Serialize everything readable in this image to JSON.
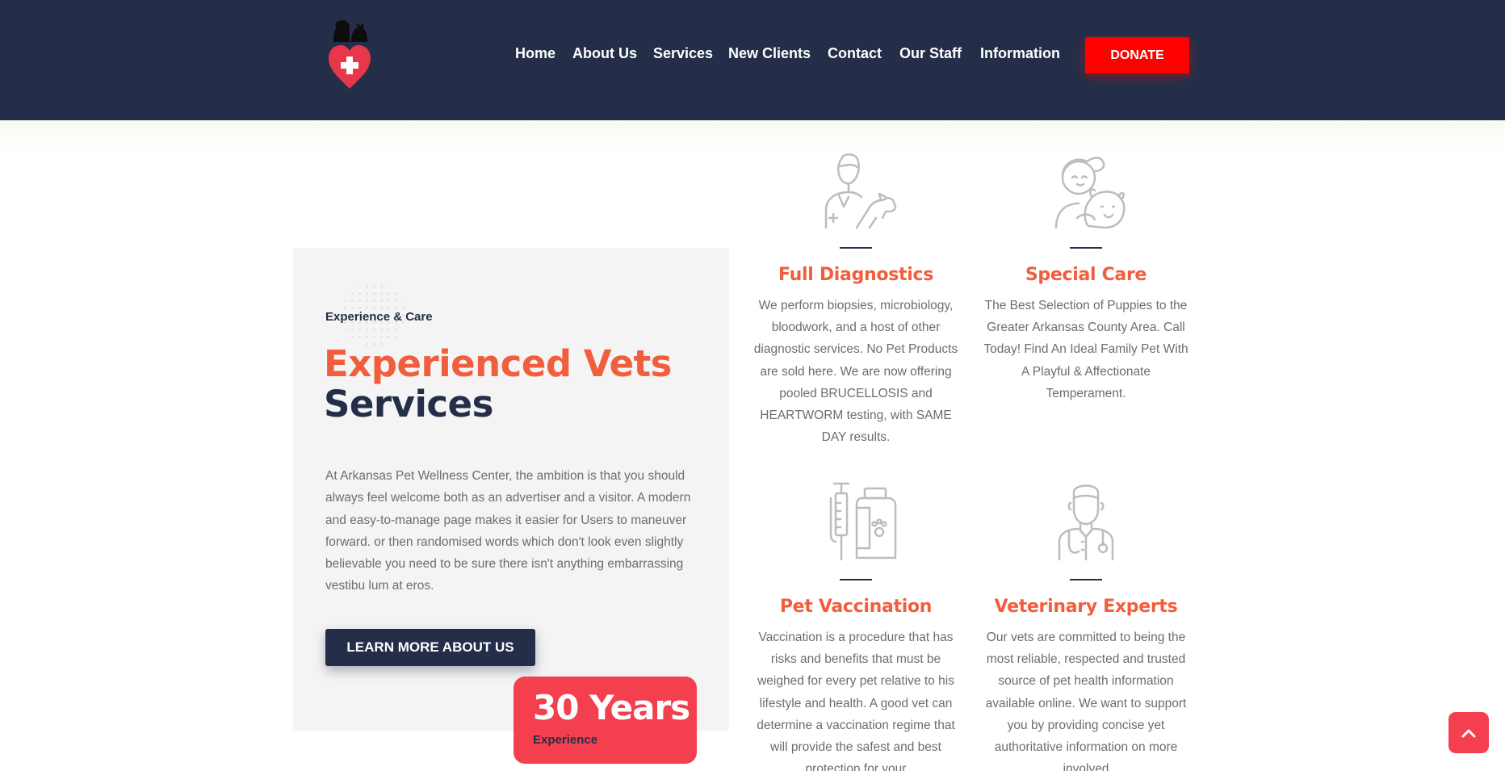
{
  "header": {
    "nav": [
      "Home",
      "About Us",
      "Services",
      "New Clients",
      "Contact",
      "Our Staff",
      "Information"
    ],
    "donate_label": "DONATE"
  },
  "about": {
    "eyebrow": "Experience & Care",
    "title_accent": "Experienced Vets",
    "title_main": "Services",
    "text": "At Arkansas Pet Wellness Center, the ambition is that you should always feel welcome both as an advertiser and a visitor. A modern and easy-to-manage page makes it easier for Users to maneuver forward. or then randomised words which don't look even slightly believable you need to be sure there isn't anything embarrassing vestibu lum at eros.",
    "button_label": "LEARN MORE ABOUT US",
    "years_number": "30 Years",
    "years_label": "Experience"
  },
  "services": [
    {
      "icon": "vet-with-dog-icon",
      "title": "Full Diagnostics",
      "text": "We perform biopsies, microbiology, bloodwork, and a host of other diagnostic services. No Pet Products are sold here. We are now offering pooled BRUCELLOSIS and HEARTWORM testing, with SAME DAY results."
    },
    {
      "icon": "girl-with-puppy-icon",
      "title": "Special Care",
      "text": "The Best Selection of Puppies to the Greater Arkansas County Area. Call Today! Find An Ideal Family Pet With A Playful & Affectionate Temperament."
    },
    {
      "icon": "syringe-and-bottle-icon",
      "title": "Pet Vaccination",
      "text": "Vaccination is a procedure that has risks and benefits that must be weighed for every pet relative to his lifestyle and health. A good vet can determine a vaccination regime that will provide the safest and best protection for your"
    },
    {
      "icon": "doctor-with-stethoscope-icon",
      "title": "Veterinary Experts",
      "text": "Our vets are committed to being the most reliable, respected and trusted source of pet health information available online. We want to support you by providing concise yet authoritative information on more involved"
    }
  ],
  "colors": {
    "navy": "#242e49",
    "accent": "#f15e3e",
    "donate_red": "#fe0000",
    "badge_red": "#f43f4f"
  }
}
